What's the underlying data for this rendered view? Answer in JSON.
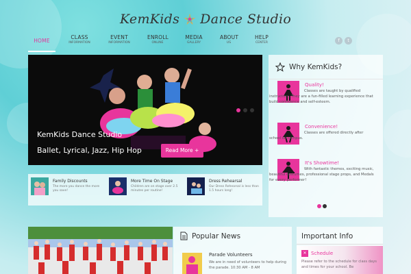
{
  "brand": {
    "left": "KemKids",
    "right": "Dance Studio",
    "logo_icon": "star-logo-icon"
  },
  "nav": [
    {
      "label": "HOME",
      "sub": ""
    },
    {
      "label": "CLASS",
      "sub": "INFORMATION"
    },
    {
      "label": "EVENT",
      "sub": "INFORMATION"
    },
    {
      "label": "ENROLL",
      "sub": "ONLINE"
    },
    {
      "label": "MEDIA",
      "sub": "GALLERY"
    },
    {
      "label": "ABOUT",
      "sub": "US"
    },
    {
      "label": "HELP",
      "sub": "CENTER"
    }
  ],
  "social": {
    "facebook": "f",
    "twitter": "t"
  },
  "hero": {
    "title": "KemKids Dance Studio",
    "subtitle": "Ballet, Lyrical, Jazz, Hip Hop",
    "button": "Read More +"
  },
  "features": [
    {
      "title": "Family Discounts",
      "text": "The more you dance the more you save!"
    },
    {
      "title": "More Time On Stage",
      "text": "Children are on stage over 2.5 minutes per routine!"
    },
    {
      "title": "Dress Rehearsal",
      "text": "Our Dress Rehearsal is less than 1.5 hours long!"
    }
  ],
  "why": {
    "title": "Why KemKids?",
    "items": [
      {
        "title": "Quality!",
        "text": "Classes are taught by qualified instructors. They are a fun-filled learning experience that build confidence and self-esteem."
      },
      {
        "title": "Convenience!",
        "text": "Classes are offered directly after school on campus."
      },
      {
        "title": "It's Showtime!",
        "text": "With fantastic themes, exciting music, beautiful costumes, professional stage props, and Medals for every performer!"
      }
    ]
  },
  "news": {
    "title": "Popular News",
    "item_title": "Parade Volunteers",
    "item_text": "We are in need of volunteers to help during the parade. 10:30 AM - 8 AM"
  },
  "info": {
    "title": "Important Info",
    "item_title": "Schedule",
    "item_text": "Please refer to the schedule for class days and times for your school. Be"
  },
  "colors": {
    "accent": "#e8359c",
    "teal": "#5fcfd6"
  }
}
